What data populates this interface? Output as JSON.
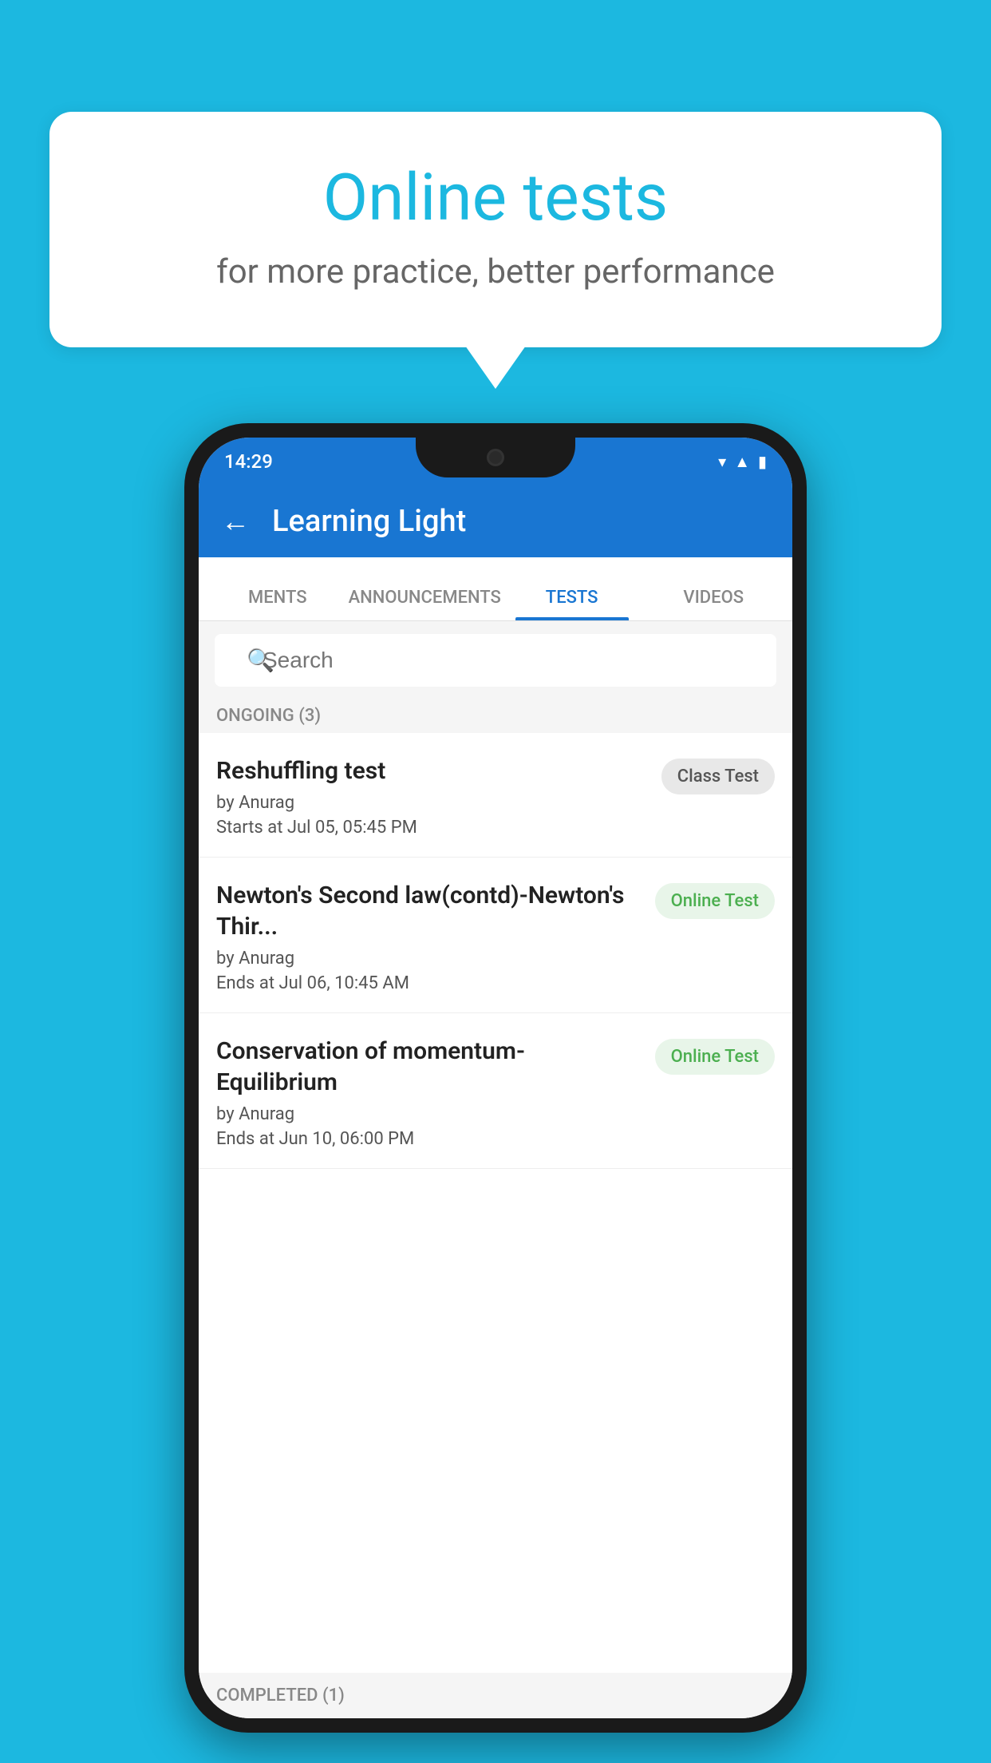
{
  "background": {
    "color": "#1cb8e0"
  },
  "speech_bubble": {
    "title": "Online tests",
    "subtitle": "for more practice, better performance"
  },
  "phone": {
    "status_bar": {
      "time": "14:29"
    },
    "app_header": {
      "back_label": "←",
      "title": "Learning Light"
    },
    "tabs": [
      {
        "label": "MENTS",
        "active": false
      },
      {
        "label": "ANNOUNCEMENTS",
        "active": false
      },
      {
        "label": "TESTS",
        "active": true
      },
      {
        "label": "VIDEOS",
        "active": false
      }
    ],
    "search": {
      "placeholder": "Search"
    },
    "ongoing_section": {
      "label": "ONGOING (3)"
    },
    "tests": [
      {
        "name": "Reshuffling test",
        "author": "by Anurag",
        "time_label": "Starts at",
        "time": "Jul 05, 05:45 PM",
        "badge": "Class Test",
        "badge_type": "class"
      },
      {
        "name": "Newton's Second law(contd)-Newton's Thir...",
        "author": "by Anurag",
        "time_label": "Ends at",
        "time": "Jul 06, 10:45 AM",
        "badge": "Online Test",
        "badge_type": "online"
      },
      {
        "name": "Conservation of momentum-Equilibrium",
        "author": "by Anurag",
        "time_label": "Ends at",
        "time": "Jun 10, 06:00 PM",
        "badge": "Online Test",
        "badge_type": "online"
      }
    ],
    "completed_section": {
      "label": "COMPLETED (1)"
    }
  }
}
